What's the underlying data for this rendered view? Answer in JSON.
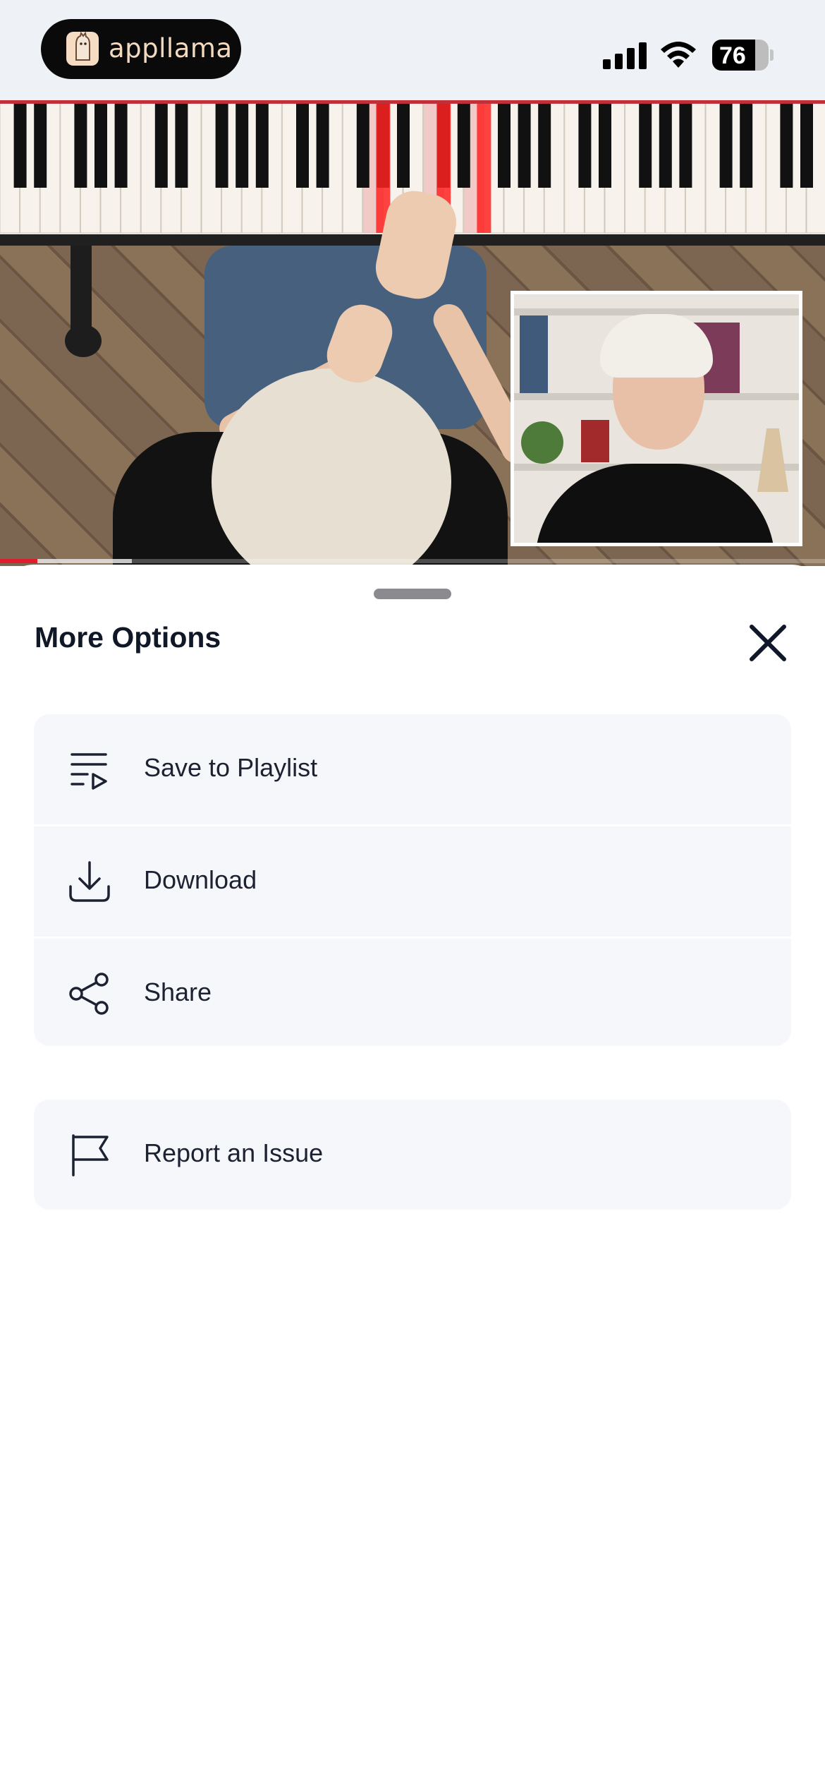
{
  "status_bar": {
    "app_name": "appllama",
    "battery_level": "76",
    "battery_fraction": 0.76,
    "logo_icon": "llama-icon",
    "signal_icon": "cellular-signal-icon",
    "wifi_icon": "wifi-icon"
  },
  "video": {
    "progress_played_fraction": 0.045,
    "progress_buffered_fraction": 0.16,
    "accent_color": "#e01d2b"
  },
  "sheet": {
    "title": "More Options",
    "close_icon": "close-icon",
    "groups": [
      {
        "items": [
          {
            "label": "Save to Playlist",
            "icon": "playlist-add-icon"
          },
          {
            "label": "Download",
            "icon": "download-icon"
          },
          {
            "label": "Share",
            "icon": "share-icon"
          }
        ]
      },
      {
        "items": [
          {
            "label": "Report an Issue",
            "icon": "flag-icon"
          }
        ]
      }
    ]
  }
}
